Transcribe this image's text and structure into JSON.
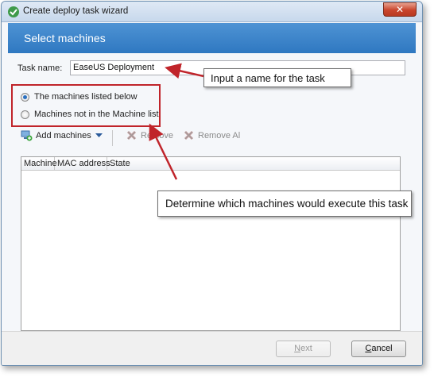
{
  "window": {
    "title": "Create deploy task wizard",
    "close_glyph": "✕"
  },
  "banner": {
    "title": "Select machines"
  },
  "task": {
    "label": "Task name:",
    "value": "EaseUS Deployment"
  },
  "radios": [
    {
      "label": "The machines listed below",
      "checked": true
    },
    {
      "label": "Machines not in the Machine list",
      "checked": false
    }
  ],
  "toolbar": {
    "add_label": "Add machines",
    "remove_label": "Remove",
    "remove_all_label": "Remove Al"
  },
  "grid": {
    "columns": [
      "Machine",
      "MAC address",
      "State"
    ]
  },
  "buttons": {
    "next_underlined": "N",
    "next_rest": "ext",
    "cancel_underlined": "C",
    "cancel_rest": "ancel"
  },
  "callouts": {
    "task_name": "Input a name for the task",
    "machines": "Determine which machines would execute this task"
  },
  "colors": {
    "banner": "#3a86cc",
    "annotation_red": "#c0242a",
    "radio_checked": "#2a6fbf"
  }
}
